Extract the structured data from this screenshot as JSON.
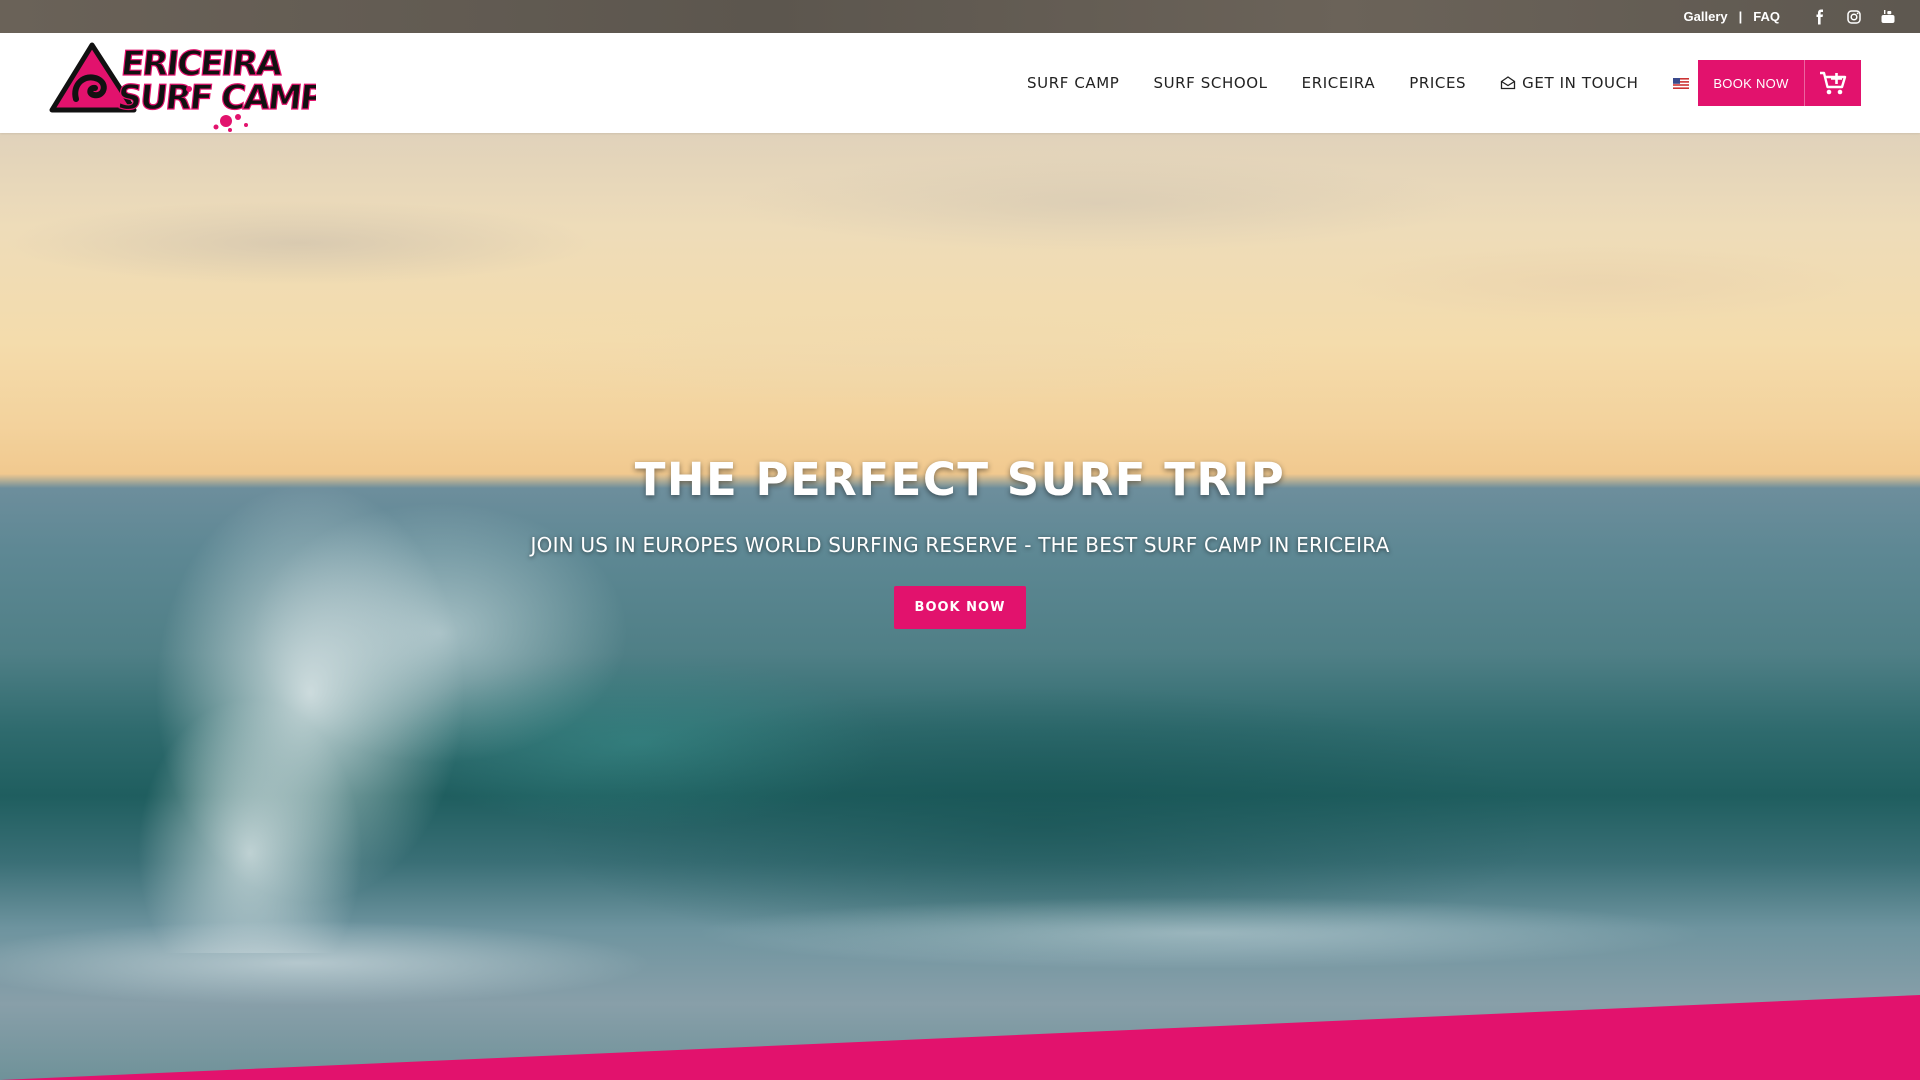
{
  "topbar": {
    "links": [
      "Gallery",
      "FAQ"
    ],
    "separator": "|",
    "social_icons": [
      "facebook-icon",
      "instagram-icon",
      "youtube-icon"
    ]
  },
  "header": {
    "logo_text": "ERICEIRA SURF CAMP",
    "nav": [
      "SURF CAMP",
      "SURF SCHOOL",
      "ERICEIRA",
      "PRICES",
      "GET IN TOUCH"
    ],
    "language_flag": "us-flag-icon",
    "book_now_label": "BOOK NOW",
    "cart_icon": "cart-add-icon"
  },
  "hero": {
    "title": "THE PERFECT SURF TRIP",
    "subtitle": "JOIN US IN EUROPES WORLD SURFING RESERVE - THE BEST SURF CAMP IN ERICEIRA",
    "button_label": "BOOK NOW"
  },
  "colors": {
    "accent": "#e2126d",
    "topbar": "#5f5850",
    "header": "#ffffff"
  }
}
